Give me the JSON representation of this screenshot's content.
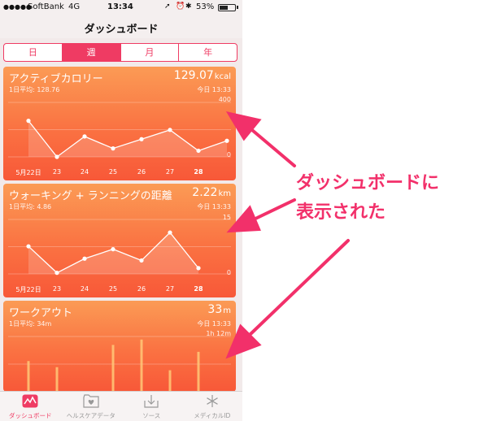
{
  "statusbar": {
    "signal": "●●●●●",
    "carrier": "SoftBank",
    "network": "4G",
    "time": "13:34",
    "battery": "53%"
  },
  "navbar": {
    "title": "ダッシュボード"
  },
  "segments": [
    {
      "label": "日",
      "active": false
    },
    {
      "label": "週",
      "active": true
    },
    {
      "label": "月",
      "active": false
    },
    {
      "label": "年",
      "active": false
    }
  ],
  "cards": [
    {
      "title": "アクティブカロリー",
      "value": "129.07",
      "unit": "kcal",
      "avg": "1日平均: 128.76",
      "today": "今日 13:33",
      "ymax": "400",
      "ymin": "0",
      "xlabels": [
        "5月22日",
        "23",
        "24",
        "25",
        "26",
        "27",
        "28"
      ]
    },
    {
      "title": "ウォーキング + ランニングの距離",
      "value": "2.22",
      "unit": "km",
      "avg": "1日平均: 4.86",
      "today": "今日 13:33",
      "ymax": "15",
      "ymin": "0",
      "xlabels": [
        "5月22日",
        "23",
        "24",
        "25",
        "26",
        "27",
        "28"
      ]
    },
    {
      "title": "ワークアウト",
      "value": "33",
      "unit": "m",
      "avg": "1日平均: 34m",
      "today": "今日 13:33",
      "ymax": "1h 12m"
    }
  ],
  "chart_data": [
    {
      "type": "line",
      "categories": [
        "5月22日",
        "23",
        "24",
        "25",
        "26",
        "27",
        "28"
      ],
      "series": [
        {
          "values": [
            265,
            0,
            150,
            62,
            130,
            198,
            45,
            118
          ]
        }
      ],
      "ylim": [
        0,
        400
      ]
    },
    {
      "type": "line",
      "categories": [
        "5月22日",
        "23",
        "24",
        "25",
        "26",
        "27",
        "28"
      ],
      "series": [
        {
          "values": [
            7.6,
            0.3,
            4.2,
            6.8,
            3.7,
            11.4,
            1.6
          ]
        }
      ],
      "ylim": [
        0,
        15
      ]
    },
    {
      "type": "bar",
      "series": [
        {
          "values": [
            40,
            32,
            0,
            61,
            68,
            28,
            52
          ]
        }
      ],
      "ylim": [
        0,
        72
      ]
    }
  ],
  "tabbar": [
    {
      "label": "ダッシュボード",
      "icon": "dashboard-icon",
      "active": true
    },
    {
      "label": "ヘルスケアデータ",
      "icon": "health-data-folder-icon",
      "active": false
    },
    {
      "label": "ソース",
      "icon": "sources-download-icon",
      "active": false
    },
    {
      "label": "メディカルID",
      "icon": "medical-id-icon",
      "active": false
    }
  ],
  "annotation": {
    "line1": "ダッシュボードに",
    "line2": "表示された",
    "color": "#f2306a"
  },
  "colors": {
    "accent": "#ef3b63",
    "card_top": "#fb9b55",
    "card_bottom": "#f85838"
  }
}
